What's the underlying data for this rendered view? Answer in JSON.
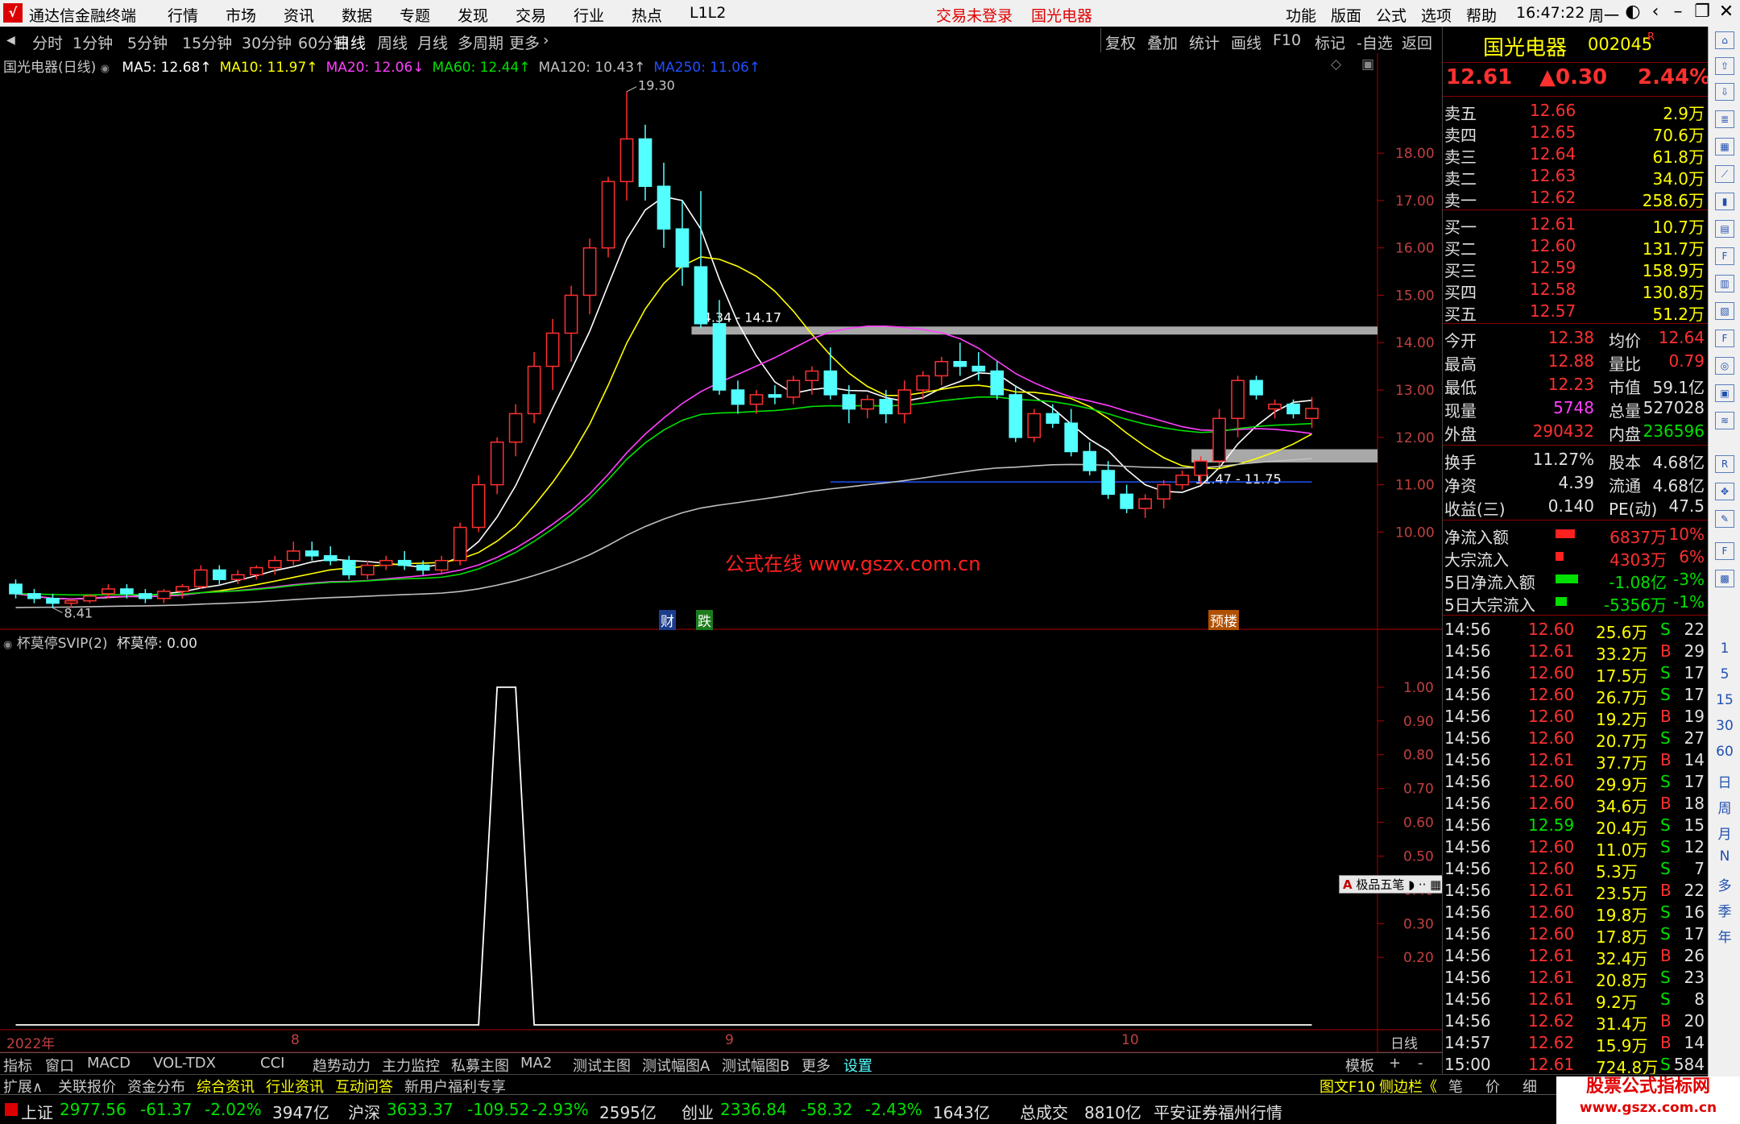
{
  "app": {
    "title": "通达信金融终端",
    "menu": [
      "行情",
      "市场",
      "资讯",
      "数据",
      "专题",
      "发现",
      "交易",
      "行业",
      "热点",
      "L1L2"
    ],
    "login_status": "交易未登录",
    "stock_in_title": "国光电器",
    "right_menu": [
      "功能",
      "版面",
      "公式",
      "选项",
      "帮助"
    ],
    "clock": "16:47:22",
    "weekday": "周一"
  },
  "periods": [
    "分时",
    "1分钟",
    "5分钟",
    "15分钟",
    "30分钟",
    "60分钟",
    "日线",
    "周线",
    "月线",
    "多周期",
    "更多"
  ],
  "active_period": "日线",
  "toolbar_right": [
    "复权",
    "叠加",
    "统计",
    "画线",
    "F10",
    "标记",
    "-自选",
    "返回"
  ],
  "main_chart": {
    "stock_label": "国光电器(日线)",
    "ma": [
      {
        "name": "MA5",
        "value": "12.68",
        "color": "#ffffff",
        "arrow": "↑"
      },
      {
        "name": "MA10",
        "value": "11.97",
        "color": "#ffff00",
        "arrow": "↑"
      },
      {
        "name": "MA20",
        "value": "12.06",
        "color": "#ff40ff",
        "arrow": "↓"
      },
      {
        "name": "MA60",
        "value": "12.44",
        "color": "#00e000",
        "arrow": "↑"
      },
      {
        "name": "MA120",
        "value": "10.43",
        "color": "#c0c0c0",
        "arrow": "↑"
      },
      {
        "name": "MA250",
        "value": "11.06",
        "color": "#2050ff",
        "arrow": "↑"
      }
    ],
    "price_ticks": [
      "18.00",
      "17.00",
      "16.00",
      "15.00",
      "14.00",
      "13.00",
      "12.00",
      "11.00",
      "10.00"
    ],
    "high_label": "19.30",
    "low_label": "8.41",
    "zone_upper_label": "14.34 - 14.17",
    "zone_lower_label": "11.47 - 11.75",
    "watermark": "公式在线  www.gszx.com.cn",
    "event_markers": [
      "财",
      "跌",
      "预楼"
    ]
  },
  "sub_chart": {
    "title": "杯莫停SVIP(2)",
    "value_label": "杯莫停: 0.00",
    "ticks": [
      "1.00",
      "0.90",
      "0.80",
      "0.70",
      "0.60",
      "0.50",
      "0.40",
      "0.30",
      "0.20"
    ],
    "ime_label": "极品五笔"
  },
  "x_axis": {
    "labels": [
      "2022年",
      "8",
      "9",
      "10"
    ],
    "period_label": "日线"
  },
  "chart_data": {
    "type": "candlestick",
    "title": "国光电器(日线)",
    "ylim": [
      8.0,
      19.6
    ],
    "candles": [
      [
        8.9,
        9.0,
        8.6,
        8.7
      ],
      [
        8.7,
        8.8,
        8.5,
        8.6
      ],
      [
        8.6,
        8.7,
        8.4,
        8.5
      ],
      [
        8.5,
        8.6,
        8.41,
        8.55
      ],
      [
        8.55,
        8.7,
        8.5,
        8.65
      ],
      [
        8.7,
        8.9,
        8.6,
        8.8
      ],
      [
        8.8,
        8.9,
        8.6,
        8.7
      ],
      [
        8.7,
        8.8,
        8.5,
        8.6
      ],
      [
        8.6,
        8.8,
        8.5,
        8.75
      ],
      [
        8.75,
        8.9,
        8.6,
        8.85
      ],
      [
        8.85,
        9.3,
        8.8,
        9.2
      ],
      [
        9.2,
        9.3,
        8.9,
        9.0
      ],
      [
        9.0,
        9.2,
        8.9,
        9.1
      ],
      [
        9.1,
        9.3,
        9.0,
        9.25
      ],
      [
        9.25,
        9.5,
        9.1,
        9.4
      ],
      [
        9.4,
        9.8,
        9.3,
        9.6
      ],
      [
        9.6,
        9.8,
        9.4,
        9.5
      ],
      [
        9.5,
        9.7,
        9.3,
        9.4
      ],
      [
        9.4,
        9.5,
        9.0,
        9.1
      ],
      [
        9.1,
        9.4,
        9.0,
        9.3
      ],
      [
        9.3,
        9.5,
        9.2,
        9.4
      ],
      [
        9.4,
        9.6,
        9.2,
        9.3
      ],
      [
        9.3,
        9.4,
        9.1,
        9.2
      ],
      [
        9.2,
        9.5,
        9.1,
        9.4
      ],
      [
        9.4,
        10.2,
        9.3,
        10.1
      ],
      [
        10.1,
        11.2,
        10.0,
        11.0
      ],
      [
        11.0,
        12.0,
        10.8,
        11.9
      ],
      [
        11.9,
        12.7,
        11.6,
        12.5
      ],
      [
        12.5,
        13.8,
        12.3,
        13.5
      ],
      [
        13.5,
        14.5,
        13.0,
        14.2
      ],
      [
        14.2,
        15.2,
        13.6,
        15.0
      ],
      [
        15.0,
        16.2,
        14.6,
        16.0
      ],
      [
        16.0,
        17.5,
        15.8,
        17.4
      ],
      [
        17.4,
        19.3,
        17.0,
        18.3
      ],
      [
        18.3,
        18.6,
        17.0,
        17.3
      ],
      [
        17.3,
        17.8,
        16.0,
        16.4
      ],
      [
        16.4,
        17.0,
        15.2,
        15.6
      ],
      [
        15.6,
        17.2,
        14.3,
        14.4
      ],
      [
        14.4,
        14.9,
        12.9,
        13.0
      ],
      [
        13.0,
        13.2,
        12.5,
        12.7
      ],
      [
        12.7,
        13.0,
        12.5,
        12.9
      ],
      [
        12.9,
        13.1,
        12.7,
        12.85
      ],
      [
        12.85,
        13.3,
        12.7,
        13.2
      ],
      [
        13.2,
        13.5,
        12.9,
        13.4
      ],
      [
        13.4,
        13.9,
        12.8,
        12.9
      ],
      [
        12.9,
        13.1,
        12.3,
        12.6
      ],
      [
        12.6,
        12.9,
        12.4,
        12.8
      ],
      [
        12.8,
        13.0,
        12.3,
        12.5
      ],
      [
        12.5,
        13.2,
        12.3,
        13.0
      ],
      [
        13.0,
        13.4,
        12.8,
        13.3
      ],
      [
        13.3,
        13.7,
        13.1,
        13.6
      ],
      [
        13.6,
        14.0,
        13.3,
        13.5
      ],
      [
        13.5,
        13.8,
        13.2,
        13.4
      ],
      [
        13.4,
        13.6,
        12.8,
        12.9
      ],
      [
        12.9,
        13.1,
        11.9,
        12.0
      ],
      [
        12.0,
        12.6,
        11.9,
        12.5
      ],
      [
        12.5,
        12.7,
        12.2,
        12.3
      ],
      [
        12.3,
        12.6,
        11.6,
        11.7
      ],
      [
        11.7,
        11.9,
        11.2,
        11.3
      ],
      [
        11.3,
        11.5,
        10.7,
        10.8
      ],
      [
        10.8,
        11.0,
        10.4,
        10.5
      ],
      [
        10.5,
        10.8,
        10.3,
        10.7
      ],
      [
        10.7,
        11.1,
        10.5,
        11.0
      ],
      [
        11.0,
        11.3,
        10.9,
        11.2
      ],
      [
        11.2,
        11.6,
        11.0,
        11.5
      ],
      [
        11.5,
        12.6,
        11.4,
        12.4
      ],
      [
        12.4,
        13.3,
        12.0,
        13.2
      ],
      [
        13.2,
        13.3,
        12.8,
        12.9
      ],
      [
        12.6,
        12.8,
        12.4,
        12.7
      ],
      [
        12.7,
        12.8,
        12.4,
        12.5
      ],
      [
        12.4,
        12.85,
        12.2,
        12.61
      ]
    ],
    "series": [
      {
        "name": "MA5",
        "color": "#ffffff"
      },
      {
        "name": "MA10",
        "color": "#ffff00"
      },
      {
        "name": "MA20",
        "color": "#ff40ff"
      },
      {
        "name": "MA60",
        "color": "#00e000"
      },
      {
        "name": "MA120",
        "color": "#c0c0c0"
      },
      {
        "name": "MA250",
        "color": "#2050ff"
      }
    ],
    "zones": [
      {
        "label": "14.34 - 14.17",
        "low": 14.17,
        "high": 14.34,
        "from_index": 37
      },
      {
        "label": "11.47 - 11.75",
        "low": 11.47,
        "high": 11.75,
        "from_index": 64
      }
    ],
    "ma250_level": 11.06,
    "indicator": {
      "name": "杯莫停",
      "ylim": [
        0.0,
        1.1
      ],
      "values": [
        0,
        0,
        0,
        0,
        0,
        0,
        0,
        0,
        0,
        0,
        0,
        0,
        0,
        0,
        0,
        0,
        0,
        0,
        0,
        0,
        0,
        0,
        0,
        0,
        0,
        0,
        1,
        1,
        0,
        0,
        0,
        0,
        0,
        0,
        0,
        0,
        0,
        0,
        0,
        0,
        0,
        0,
        0,
        0,
        0,
        0,
        0,
        0,
        0,
        0,
        0,
        0,
        0,
        0,
        0,
        0,
        0,
        0,
        0,
        0,
        0,
        0,
        0,
        0,
        0,
        0,
        0,
        0,
        0,
        0,
        0
      ]
    }
  },
  "quote": {
    "name": "国光电器",
    "code": "002045",
    "code_suffix": "R",
    "price": "12.61",
    "change": "▲0.30",
    "change_pct": "2.44%",
    "asks": [
      {
        "label": "卖五",
        "price": "12.66",
        "vol": "2.9万"
      },
      {
        "label": "卖四",
        "price": "12.65",
        "vol": "70.6万"
      },
      {
        "label": "卖三",
        "price": "12.64",
        "vol": "61.8万"
      },
      {
        "label": "卖二",
        "price": "12.63",
        "vol": "34.0万"
      },
      {
        "label": "卖一",
        "price": "12.62",
        "vol": "258.6万"
      }
    ],
    "bids": [
      {
        "label": "买一",
        "price": "12.61",
        "vol": "10.7万"
      },
      {
        "label": "买二",
        "price": "12.60",
        "vol": "131.7万"
      },
      {
        "label": "买三",
        "price": "12.59",
        "vol": "158.9万"
      },
      {
        "label": "买四",
        "price": "12.58",
        "vol": "130.8万"
      },
      {
        "label": "买五",
        "price": "12.57",
        "vol": "51.2万"
      }
    ],
    "stats": [
      {
        "l1": "今开",
        "v1": "12.38",
        "c1": "red",
        "l2": "均价",
        "v2": "12.64",
        "c2": "red"
      },
      {
        "l1": "最高",
        "v1": "12.88",
        "c1": "red",
        "l2": "量比",
        "v2": "0.79",
        "c2": "red"
      },
      {
        "l1": "最低",
        "v1": "12.23",
        "c1": "red",
        "l2": "市值",
        "v2": "59.1亿",
        "c2": "white"
      },
      {
        "l1": "现量",
        "v1": "5748",
        "c1": "magenta",
        "l2": "总量",
        "v2": "527028",
        "c2": "white"
      },
      {
        "l1": "外盘",
        "v1": "290432",
        "c1": "red",
        "l2": "内盘",
        "v2": "236596",
        "c2": "green"
      }
    ],
    "stats2": [
      {
        "l1": "换手",
        "v1": "11.27%",
        "l2": "股本",
        "v2": "4.68亿"
      },
      {
        "l1": "净资",
        "v1": "4.39",
        "l2": "流通",
        "v2": "4.68亿"
      },
      {
        "l1": "收益(三)",
        "v1": "0.140",
        "l2": "PE(动)",
        "v2": "47.5"
      }
    ],
    "flows": [
      {
        "label": "净流入额",
        "value": "6837万",
        "pct": "10%",
        "color": "red"
      },
      {
        "label": "大宗流入",
        "value": "4303万",
        "pct": "6%",
        "color": "red"
      },
      {
        "label": "5日净流入额",
        "value": "-1.08亿",
        "pct": "-3%",
        "color": "green"
      },
      {
        "label": "5日大宗流入",
        "value": "-5356万",
        "pct": "-1%",
        "color": "green"
      }
    ],
    "flow_bar_fill": [
      0.6,
      0.25,
      0.7,
      0.35
    ],
    "ticks": [
      {
        "t": "14:56",
        "p": "12.60",
        "v": "25.6万",
        "s": "S",
        "n": "22"
      },
      {
        "t": "14:56",
        "p": "12.61",
        "v": "33.2万",
        "s": "B",
        "n": "29"
      },
      {
        "t": "14:56",
        "p": "12.60",
        "v": "17.5万",
        "s": "S",
        "n": "17"
      },
      {
        "t": "14:56",
        "p": "12.60",
        "v": "26.7万",
        "s": "S",
        "n": "17"
      },
      {
        "t": "14:56",
        "p": "12.60",
        "v": "19.2万",
        "s": "B",
        "n": "19"
      },
      {
        "t": "14:56",
        "p": "12.60",
        "v": "20.7万",
        "s": "S",
        "n": "27"
      },
      {
        "t": "14:56",
        "p": "12.61",
        "v": "37.7万",
        "s": "B",
        "n": "14"
      },
      {
        "t": "14:56",
        "p": "12.60",
        "v": "29.9万",
        "s": "S",
        "n": "17"
      },
      {
        "t": "14:56",
        "p": "12.60",
        "v": "34.6万",
        "s": "B",
        "n": "18"
      },
      {
        "t": "14:56",
        "p": "12.59",
        "v": "20.4万",
        "s": "S",
        "n": "15"
      },
      {
        "t": "14:56",
        "p": "12.60",
        "v": "11.0万",
        "s": "S",
        "n": "12"
      },
      {
        "t": "14:56",
        "p": "12.60",
        "v": "5.3万",
        "s": "S",
        "n": "7"
      },
      {
        "t": "14:56",
        "p": "12.61",
        "v": "23.5万",
        "s": "B",
        "n": "22"
      },
      {
        "t": "14:56",
        "p": "12.60",
        "v": "19.8万",
        "s": "S",
        "n": "16"
      },
      {
        "t": "14:56",
        "p": "12.60",
        "v": "17.8万",
        "s": "S",
        "n": "17"
      },
      {
        "t": "14:56",
        "p": "12.61",
        "v": "32.4万",
        "s": "B",
        "n": "26"
      },
      {
        "t": "14:56",
        "p": "12.61",
        "v": "20.8万",
        "s": "S",
        "n": "23"
      },
      {
        "t": "14:56",
        "p": "12.61",
        "v": "9.2万",
        "s": "S",
        "n": "8"
      },
      {
        "t": "14:56",
        "p": "12.62",
        "v": "31.4万",
        "s": "B",
        "n": "20"
      },
      {
        "t": "14:57",
        "p": "12.62",
        "v": "15.9万",
        "s": "B",
        "n": "14"
      },
      {
        "t": "15:00",
        "p": "12.61",
        "v": "724.8万",
        "s": "S",
        "n": "584"
      }
    ]
  },
  "rtool_labels": [
    "1",
    "5",
    "15",
    "30",
    "60",
    "日",
    "周",
    "月",
    "N",
    "多",
    "季",
    "年"
  ],
  "tabs1": [
    "指标",
    "窗口",
    "MACD",
    "VOL-TDX",
    "CCI",
    "趋势动力",
    "主力监控",
    "私募主图",
    "MA2",
    "测试主图",
    "测试幅图A",
    "测试幅图B",
    "更多",
    "设置"
  ],
  "tabs1_right": [
    "模板",
    "+",
    "-"
  ],
  "tabs2": [
    "扩展∧",
    "关联报价",
    "资金分布",
    "综合资讯",
    "行业资讯",
    "互动问答",
    "新用户福利专享"
  ],
  "tabs2_right": [
    "图文F10",
    "侧边栏《",
    "笔",
    "价",
    "细",
    "势"
  ],
  "status": [
    {
      "name": "上证",
      "v": "2977.56",
      "c": "-61.37",
      "p": "-2.02%",
      "amt": "3947亿"
    },
    {
      "name": "沪深",
      "v": "3633.37",
      "c": "-109.52",
      "p": "-2.93%",
      "amt": "2595亿"
    },
    {
      "name": "创业",
      "v": "2336.84",
      "c": "-58.32",
      "p": "-2.43%",
      "amt": "1643亿"
    }
  ],
  "total_label": "总成交",
  "total_value": "8810亿",
  "broker": "平安证券福州行情",
  "watermark_logo": {
    "line1": "股票公式指标网",
    "line2": "www.gszx.com.cn"
  }
}
